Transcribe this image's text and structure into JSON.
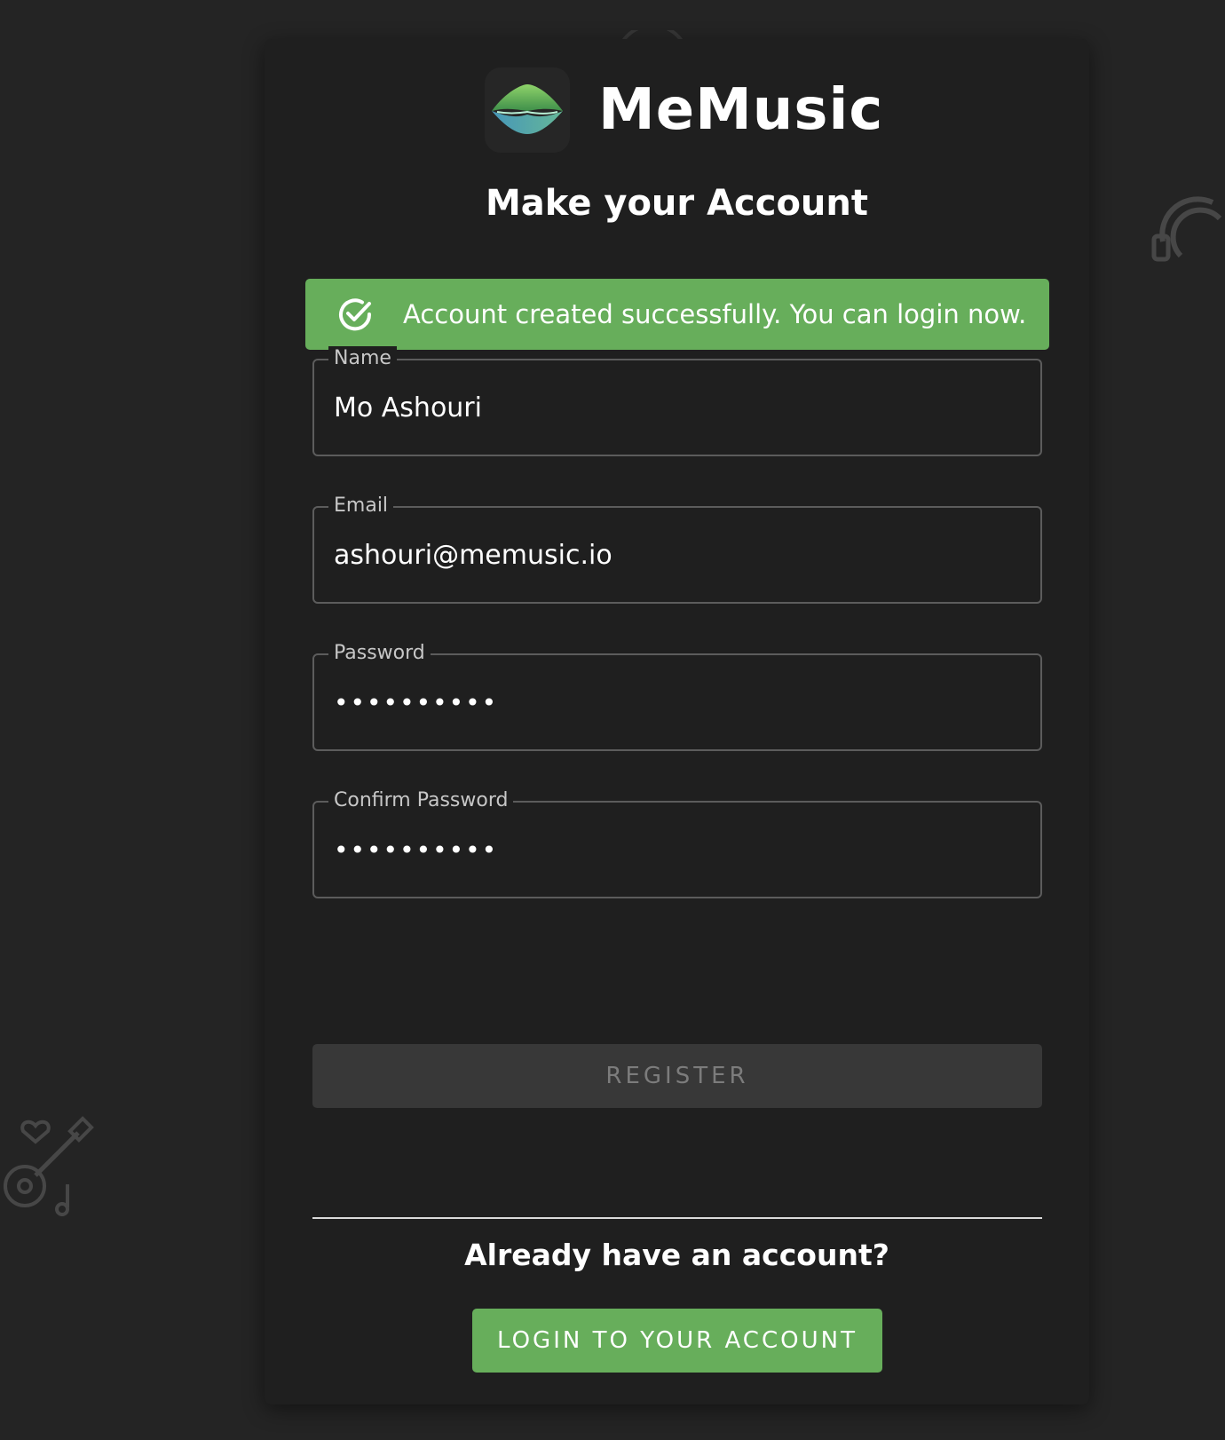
{
  "brand": {
    "name": "MeMusic"
  },
  "heading": "Make your Account",
  "alert": {
    "message": "Account created successfully. You can login now."
  },
  "form": {
    "name": {
      "label": "Name",
      "value": "Mo Ashouri"
    },
    "email": {
      "label": "Email",
      "value": "ashouri@memusic.io"
    },
    "password": {
      "label": "Password",
      "value": "••••••••••"
    },
    "confirm_password": {
      "label": "Confirm Password",
      "value": "••••••••••"
    },
    "register_label": "REGISTER"
  },
  "footer": {
    "prompt": "Already have an account?",
    "login_label": "LOGIN TO YOUR ACCOUNT"
  },
  "colors": {
    "background": "#242424",
    "card": "#1f1f1f",
    "accent_green": "#67ae5b",
    "disabled_button": "#383838"
  }
}
